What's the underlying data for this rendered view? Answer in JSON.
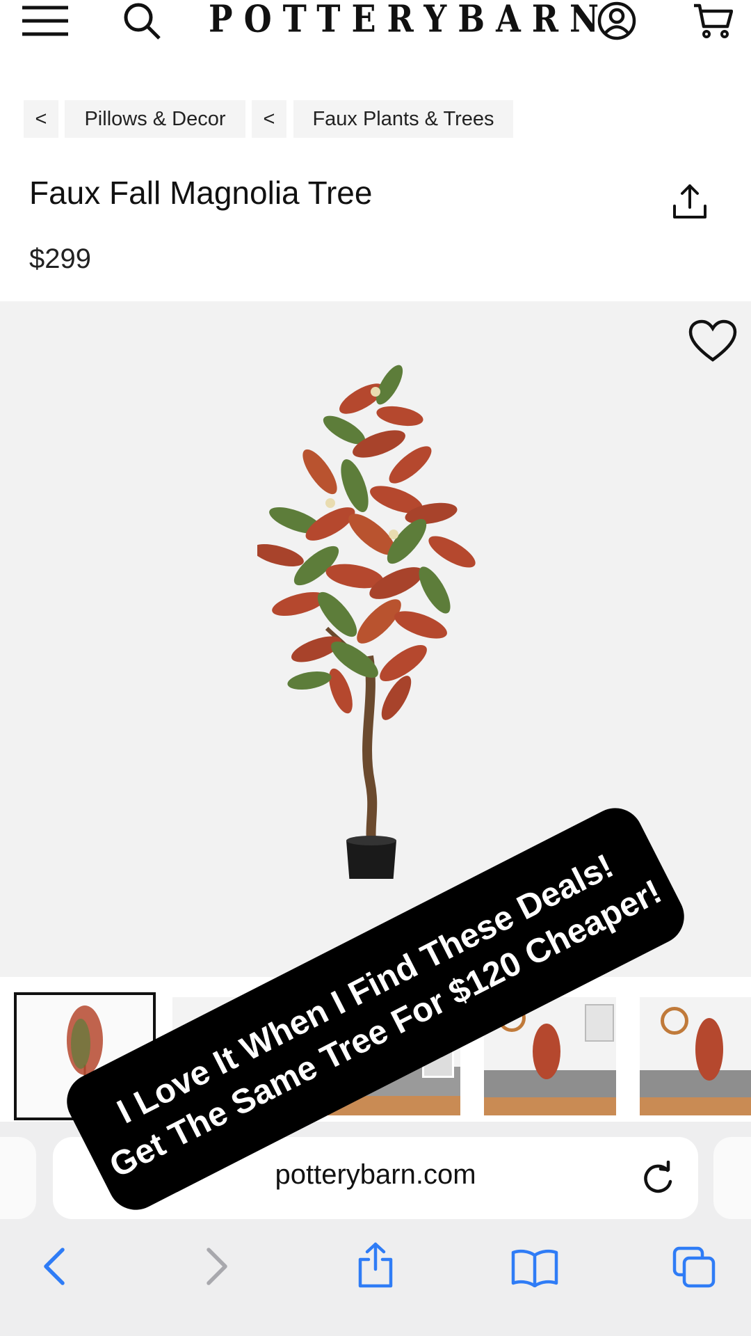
{
  "header": {
    "brand": "POTTERYBARN",
    "icons": [
      "menu-icon",
      "search-icon",
      "account-icon",
      "cart-icon"
    ]
  },
  "breadcrumbs": [
    {
      "arrow": "<",
      "label": "Pillows & Decor"
    },
    {
      "arrow": "<",
      "label": "Faux Plants & Trees"
    }
  ],
  "product": {
    "title": "Faux Fall Magnolia Tree",
    "price": "$299"
  },
  "overlay": {
    "line1": "I Love It When I Find These Deals!",
    "line2": "Get The Same Tree For $120 Cheaper!"
  },
  "browser": {
    "url": "potterybarn.com",
    "toolbar_icons": [
      "back-icon",
      "forward-icon",
      "share-icon",
      "bookmarks-icon",
      "tabs-icon"
    ]
  },
  "colors": {
    "ios_blue": "#2f7cf6",
    "leaf_red": "#b5482e",
    "leaf_green": "#5d7d3a"
  }
}
